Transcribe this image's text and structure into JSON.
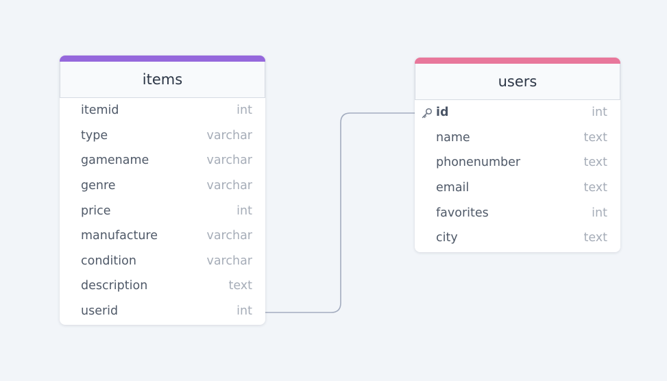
{
  "tables": [
    {
      "id": "items",
      "name": "items",
      "accent_color": "#9568dc",
      "fields": [
        {
          "name": "itemid",
          "type": "int",
          "pk": false
        },
        {
          "name": "type",
          "type": "varchar",
          "pk": false
        },
        {
          "name": "gamename",
          "type": "varchar",
          "pk": false
        },
        {
          "name": "genre",
          "type": "varchar",
          "pk": false
        },
        {
          "name": "price",
          "type": "int",
          "pk": false
        },
        {
          "name": "manufacture",
          "type": "varchar",
          "pk": false
        },
        {
          "name": "condition",
          "type": "varchar",
          "pk": false
        },
        {
          "name": "description",
          "type": "text",
          "pk": false
        },
        {
          "name": "userid",
          "type": "int",
          "pk": false
        }
      ]
    },
    {
      "id": "users",
      "name": "users",
      "accent_color": "#e8779b",
      "fields": [
        {
          "name": "id",
          "type": "int",
          "pk": true
        },
        {
          "name": "name",
          "type": "text",
          "pk": false
        },
        {
          "name": "phonenumber",
          "type": "text",
          "pk": false
        },
        {
          "name": "email",
          "type": "text",
          "pk": false
        },
        {
          "name": "favorites",
          "type": "int",
          "pk": false
        },
        {
          "name": "city",
          "type": "text",
          "pk": false
        }
      ]
    }
  ],
  "relationships": [
    {
      "from_table": "items",
      "from_field": "userid",
      "to_table": "users",
      "to_field": "id"
    }
  ],
  "colors": {
    "background": "#f2f5f9",
    "connector": "#a3acbf"
  }
}
